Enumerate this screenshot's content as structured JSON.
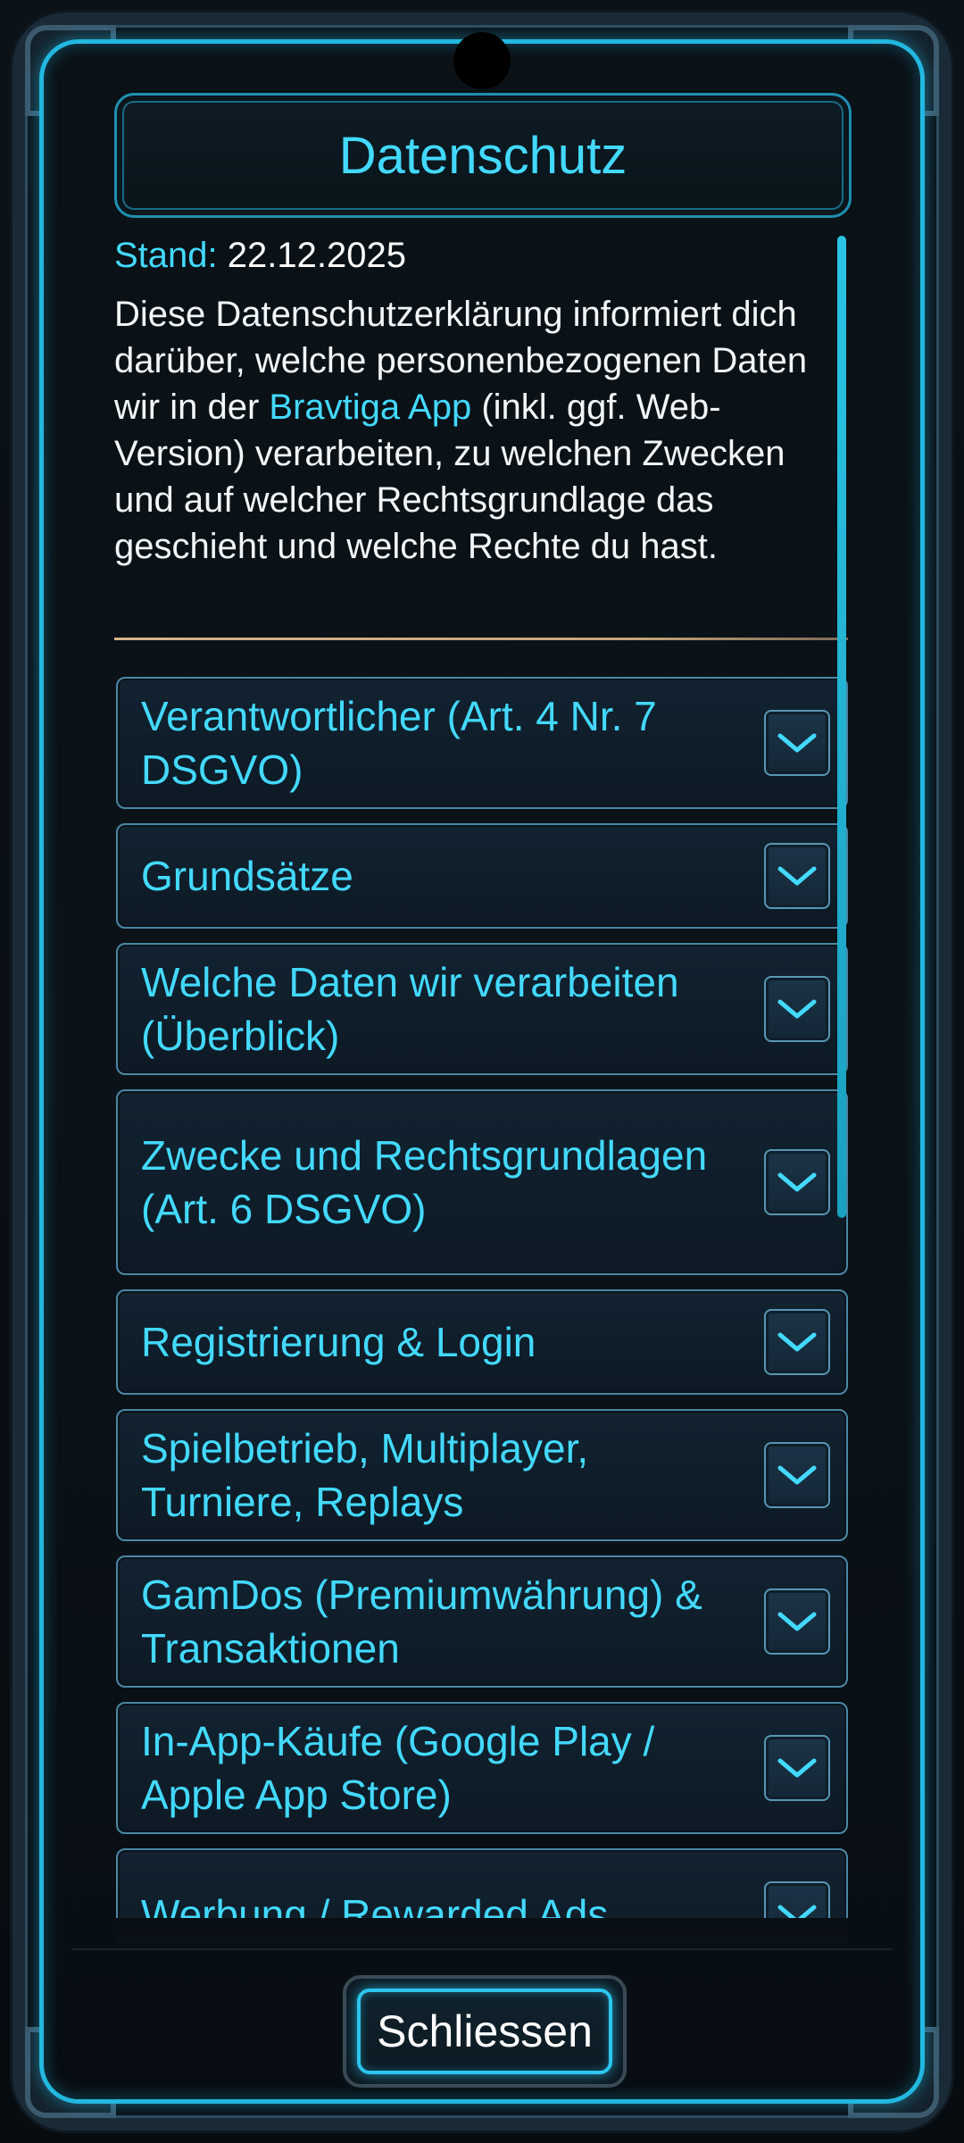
{
  "dialog": {
    "title": "Datenschutz",
    "stand_label": "Stand:",
    "stand_date": "22.12.2025",
    "intro_before": "Diese Datenschutzerklärung informiert dich darüber, welche personenbezogenen Daten wir in der ",
    "intro_link": "Bravtiga App",
    "intro_after": " (inkl. ggf. Web-Version) verarbeiten, zu welchen Zwecken und auf welcher Rechtsgrundlage das geschieht und welche Rechte du hast."
  },
  "sections": [
    {
      "label": "Verantwortlicher (Art. 4 Nr. 7 DSGVO)",
      "icon": "chevron-down-icon"
    },
    {
      "label": "Grundsätze",
      "icon": "chevron-down-icon"
    },
    {
      "label": "Welche Daten wir verarbeiten (Überblick)",
      "icon": "chevron-down-icon"
    },
    {
      "label": "Zwecke und Rechtsgrundlagen (Art. 6 DSGVO)",
      "icon": "chevron-down-icon"
    },
    {
      "label": "Registrierung & Login",
      "icon": "chevron-down-icon"
    },
    {
      "label": "Spielbetrieb, Multiplayer, Turniere, Replays",
      "icon": "chevron-down-icon"
    },
    {
      "label": "GamDos (Premiumwährung) & Transaktionen",
      "icon": "chevron-down-icon"
    },
    {
      "label": "In-App-Käufe (Google Play / Apple App Store)",
      "icon": "chevron-down-icon"
    },
    {
      "label": "Werbung / Rewarded Ads",
      "icon": "chevron-down-icon"
    }
  ],
  "footer": {
    "close_label": "Schliessen"
  },
  "colors": {
    "accent": "#43d9ff",
    "frame_glow": "#22b8e0",
    "divider": "#d6b58a"
  }
}
